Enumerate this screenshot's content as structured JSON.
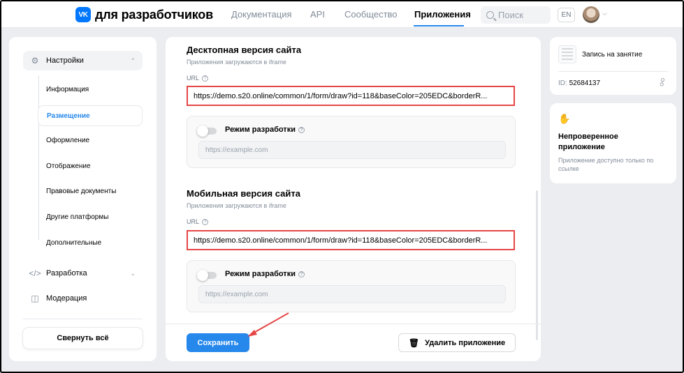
{
  "header": {
    "logo_mark": "VK",
    "logo_text": "для разработчиков",
    "nav": [
      "Документация",
      "API",
      "Сообщество",
      "Приложения"
    ],
    "search_placeholder": "Поиск",
    "lang": "EN",
    "avatar_icon": "user-avatar"
  },
  "sidebar": {
    "settings_label": "Настройки",
    "items": [
      "Информация",
      "Размещение",
      "Оформление",
      "Отображение",
      "Правовые документы",
      "Другие платформы",
      "Дополнительные"
    ],
    "active_item": "Размещение",
    "development_label": "Разработка",
    "moderation_label": "Модерация",
    "collapse_label": "Свернуть всё"
  },
  "desktop": {
    "title": "Десктопная версия сайта",
    "subtitle": "Приложения загружаются в iframe",
    "url_label": "URL",
    "url_value": "https://demo.s20.online/common/1/form/draw?id=118&baseColor=205EDC&borderR...",
    "dev_mode_label": "Режим разработки",
    "dev_url_placeholder": "https://example.com"
  },
  "mobile": {
    "title": "Мобильная версия сайта",
    "subtitle": "Приложения загружаются в iframe",
    "url_label": "URL",
    "url_value": "https://demo.s20.online/common/1/form/draw?id=118&baseColor=205EDC&borderR...",
    "dev_mode_label": "Режим разработки",
    "dev_url_placeholder": "https://example.com"
  },
  "actions": {
    "save_label": "Сохранить",
    "delete_label": "Удалить приложение"
  },
  "app_card": {
    "name": "Запись на занятие",
    "id_label": "ID:",
    "id_value": "52684137"
  },
  "status_card": {
    "title": "Непроверенное приложение",
    "text": "Приложение доступно только по ссылке"
  },
  "colors": {
    "accent": "#2688eb",
    "highlight_border": "#e64646",
    "vk_blue": "#0077ff"
  }
}
